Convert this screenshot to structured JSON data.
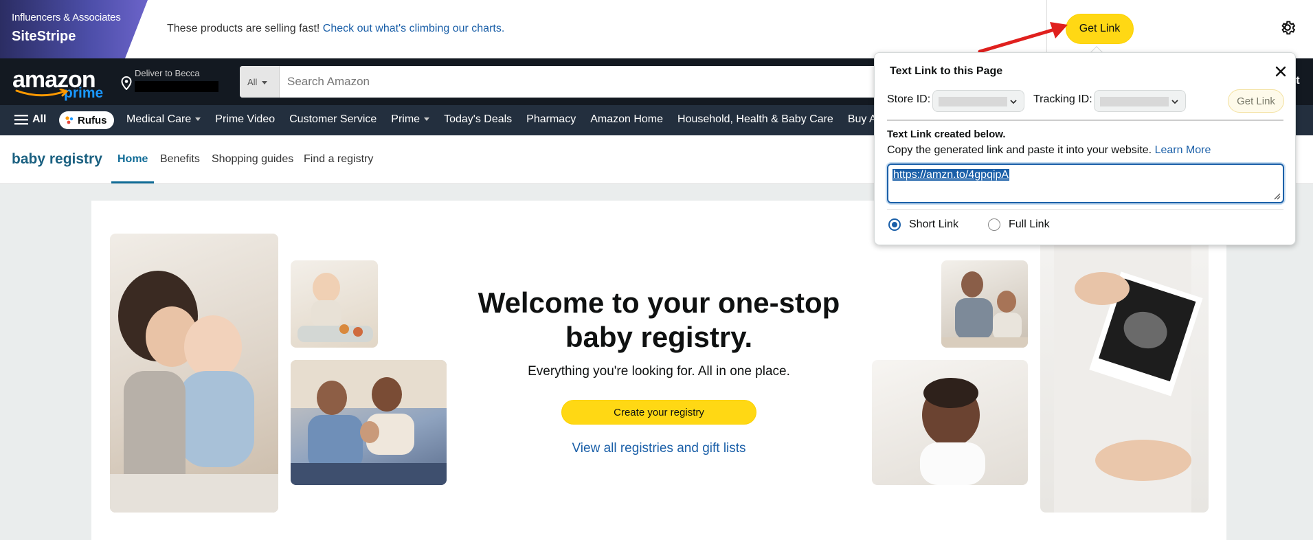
{
  "sitestripe": {
    "brand_sub": "Influencers & Associates",
    "brand_name": "SiteStripe",
    "message": "These products are selling fast!",
    "message_link": "Check out what's climbing our charts.",
    "get_link_label": "Get Link",
    "settings_icon": "gear-icon"
  },
  "header": {
    "logo_text": "amazon",
    "logo_sub": "prime",
    "deliver_label": "Deliver to Becca",
    "search_category": "All",
    "search_placeholder": "Search Amazon",
    "cart_fragment": "rt"
  },
  "nav": {
    "all_label": "All",
    "rufus_label": "Rufus",
    "items": [
      {
        "label": "Medical Care",
        "dropdown": true
      },
      {
        "label": "Prime Video",
        "dropdown": false
      },
      {
        "label": "Customer Service",
        "dropdown": false
      },
      {
        "label": "Prime",
        "dropdown": true
      },
      {
        "label": "Today's Deals",
        "dropdown": false
      },
      {
        "label": "Pharmacy",
        "dropdown": false
      },
      {
        "label": "Amazon Home",
        "dropdown": false
      },
      {
        "label": "Household, Health & Baby Care",
        "dropdown": false
      },
      {
        "label": "Buy Aga",
        "dropdown": false
      }
    ]
  },
  "registry_nav": {
    "title": "baby registry",
    "tabs": [
      "Home",
      "Benefits",
      "Shopping guides",
      "Find a registry"
    ]
  },
  "hero": {
    "title_line1": "Welcome to your one-stop",
    "title_line2": "baby registry.",
    "subtitle": "Everything you're looking for. All in one place.",
    "cta_label": "Create your registry",
    "link_label": "View all registries and gift lists"
  },
  "popup": {
    "title": "Text Link to this Page",
    "store_id_label": "Store ID:",
    "tracking_id_label": "Tracking ID:",
    "get_link_label": "Get Link",
    "created_heading": "Text Link created below.",
    "copy_text": "Copy the generated link and paste it into your website.",
    "learn_more": "Learn More",
    "link_value": "https://amzn.to/4gpqipA",
    "radio_short": "Short Link",
    "radio_full": "Full Link",
    "selected_link_type": "Short Link"
  },
  "colors": {
    "accent_yellow": "#ffd814",
    "link_blue": "#1a5fa8",
    "header_dark": "#131921",
    "nav_dark": "#232f3e",
    "registry_teal": "#0f6b96",
    "arrow_red": "#e0201e"
  }
}
